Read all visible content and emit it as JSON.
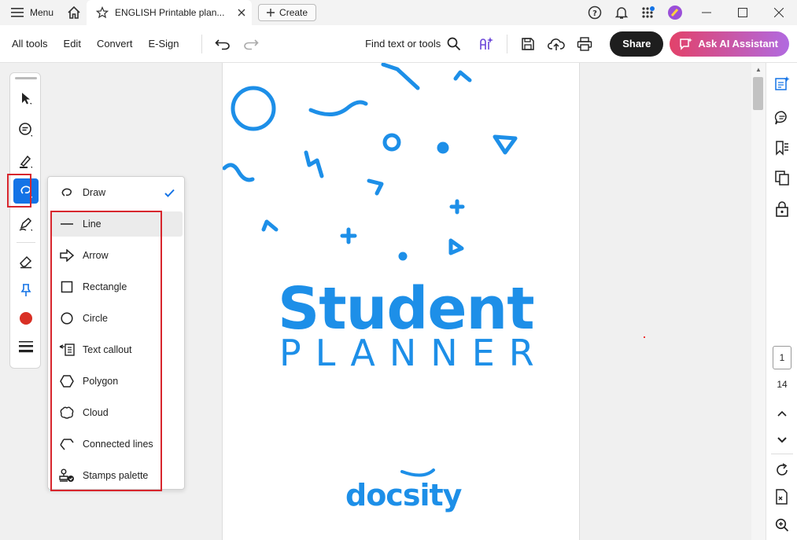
{
  "titlebar": {
    "menu_label": "Menu",
    "tab_title": "ENGLISH Printable plan...",
    "create_label": "Create"
  },
  "toolbar": {
    "menus": [
      "All tools",
      "Edit",
      "Convert",
      "E-Sign"
    ],
    "find_label": "Find text or tools",
    "share_label": "Share",
    "ai_label": "Ask AI Assistant"
  },
  "left_tools": [
    "select-tool",
    "comment-tool",
    "highlight-tool",
    "draw-tool",
    "sign-tool",
    "eraser-tool",
    "pin-tool",
    "color-picker",
    "line-weight"
  ],
  "colors": {
    "accent": "#1473e6",
    "highlight_box": "#d7262d",
    "doc_blue": "#1d8fe8",
    "tool_color": "#d93025"
  },
  "dropdown": {
    "items": [
      {
        "label": "Draw",
        "icon": "draw-icon",
        "checked": true
      },
      {
        "label": "Line",
        "icon": "line-icon"
      },
      {
        "label": "Arrow",
        "icon": "arrow-icon"
      },
      {
        "label": "Rectangle",
        "icon": "rectangle-icon"
      },
      {
        "label": "Circle",
        "icon": "circle-icon"
      },
      {
        "label": "Text callout",
        "icon": "text-callout-icon"
      },
      {
        "label": "Polygon",
        "icon": "polygon-icon"
      },
      {
        "label": "Cloud",
        "icon": "cloud-icon"
      },
      {
        "label": "Connected lines",
        "icon": "connected-lines-icon"
      },
      {
        "label": "Stamps palette",
        "icon": "stamp-icon"
      }
    ]
  },
  "document": {
    "title_line1": "Student",
    "title_line2": "PLANNER",
    "brand": "docsity"
  },
  "pagination": {
    "current": "1",
    "total": "14"
  }
}
